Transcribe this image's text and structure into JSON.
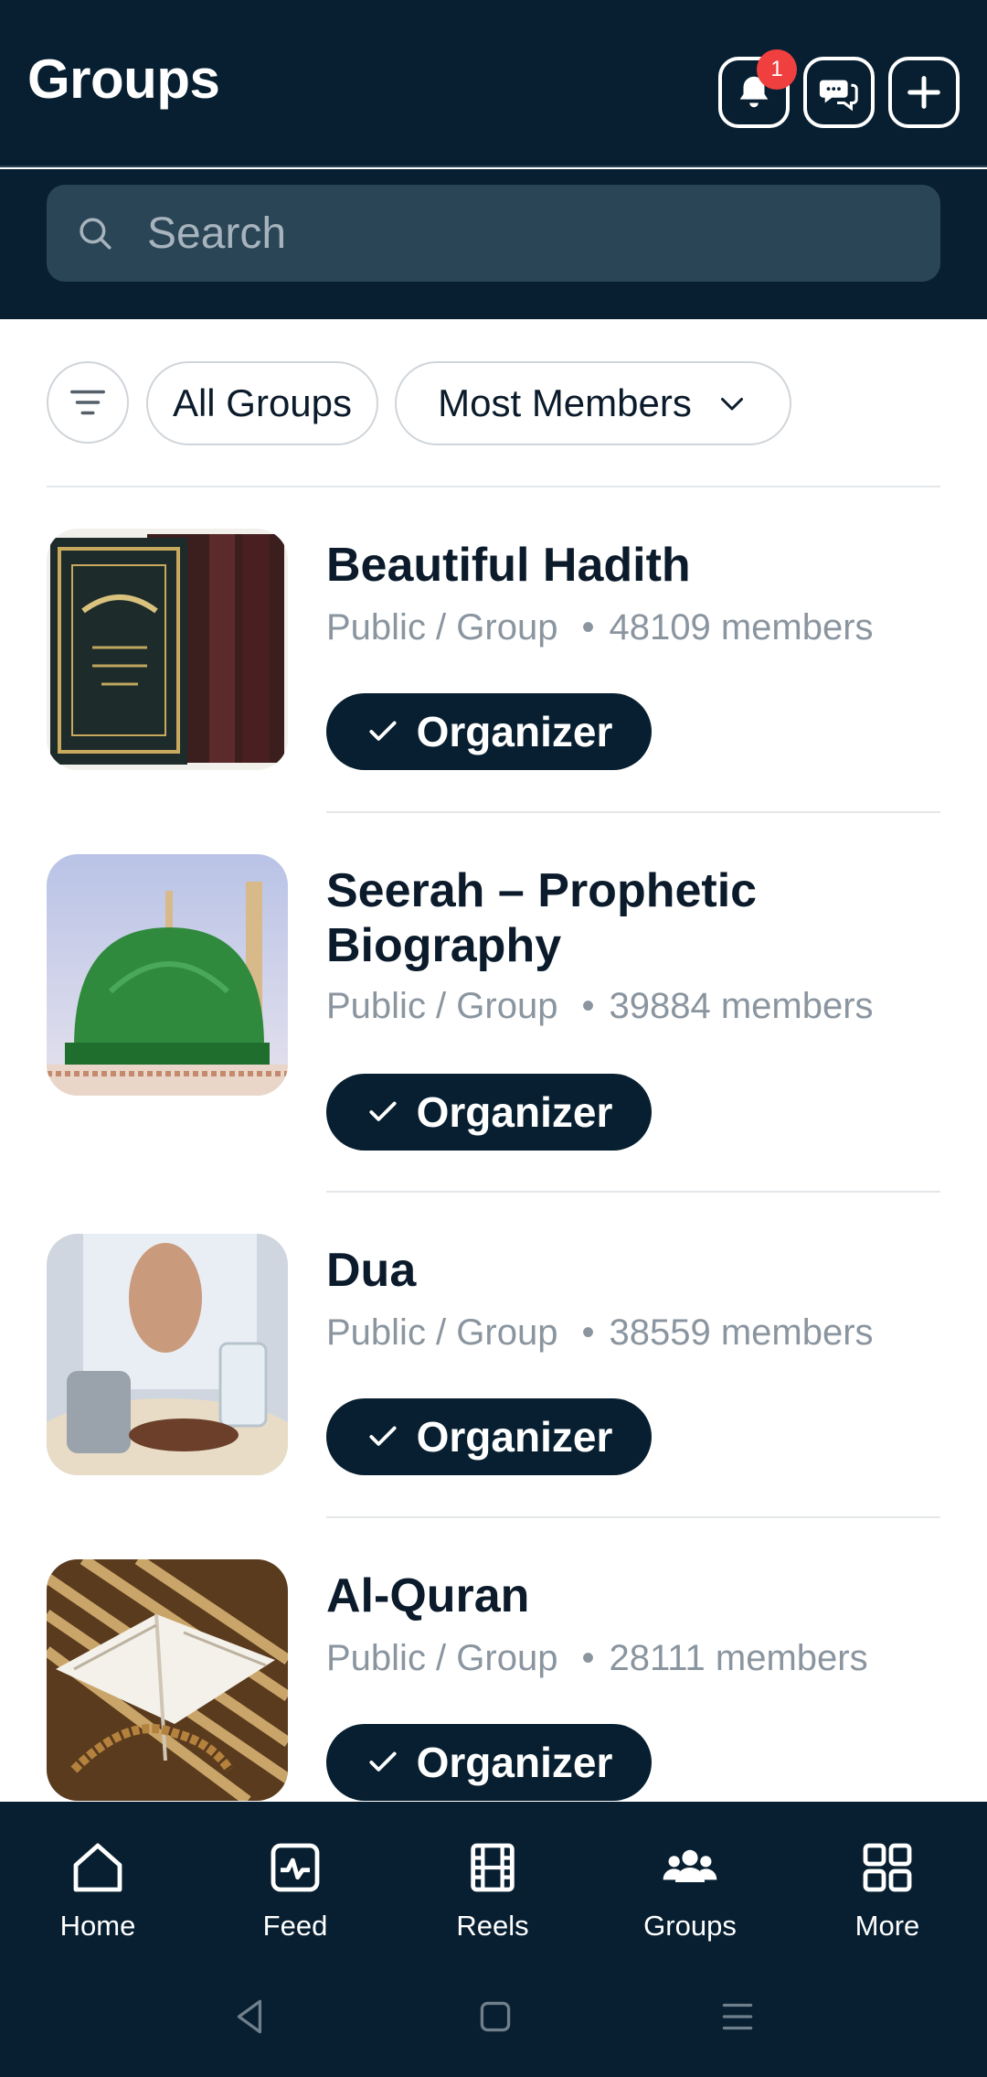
{
  "header": {
    "title": "Groups",
    "notification_count": "1",
    "icons": [
      "bell-icon",
      "chat-icon",
      "plus-icon"
    ]
  },
  "search": {
    "placeholder": "Search"
  },
  "filters": {
    "all_groups": "All Groups",
    "sort": "Most Members"
  },
  "groups": [
    {
      "name": "Beautiful Hadith",
      "type": "Public / Group",
      "members": "48109 members",
      "role": "Organizer"
    },
    {
      "name": "Seerah – Prophetic Biography",
      "type": "Public / Group",
      "members": "39884 members",
      "role": "Organizer"
    },
    {
      "name": "Dua",
      "type": "Public / Group",
      "members": "38559 members",
      "role": "Organizer"
    },
    {
      "name": "Al-Quran",
      "type": "Public / Group",
      "members": "28111 members",
      "role": "Organizer"
    }
  ],
  "nav": {
    "home": "Home",
    "feed": "Feed",
    "reels": "Reels",
    "groups": "Groups",
    "more": "More"
  },
  "colors": {
    "header_bg": "#071f30",
    "search_bg": "#2a4556",
    "badge": "#ef3f3f"
  }
}
